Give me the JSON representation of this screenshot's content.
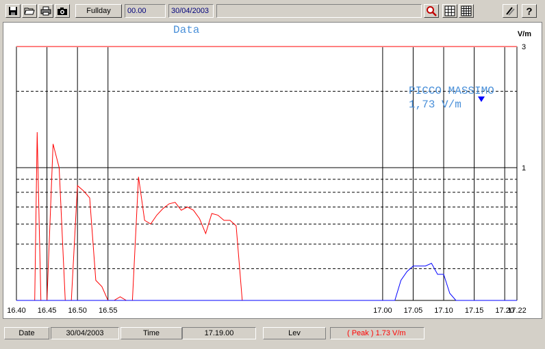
{
  "toolbar": {
    "range_label": "Fullday",
    "time_value": "00.00",
    "date_value": "30/04/2003",
    "icons": [
      "save-icon",
      "open-folder-icon",
      "print-icon",
      "camera-icon",
      "zoom-icon",
      "grid-icon",
      "grid-dense-icon",
      "tools-icon",
      "help-icon"
    ]
  },
  "chart_data": {
    "type": "line",
    "title": "Data",
    "ylabel": "V/m",
    "y_tick_labels": [
      "3",
      "1"
    ],
    "x_tick_labels": [
      "16.40",
      "16.45",
      "16.50",
      "16.55",
      "17.00",
      "17.05",
      "17.10",
      "17.15",
      "17.20",
      "17.22"
    ],
    "x_range": [
      16.4,
      17.22
    ],
    "y_scale": "log",
    "y_range": [
      0.3,
      3
    ],
    "limit_line": 3,
    "annotation": {
      "line1": "PICCO MASSIMO",
      "line2": "1,73 V/m",
      "x": 17.19,
      "y": 1.73
    },
    "series": [
      {
        "color": "#ff0000",
        "points": [
          [
            16.4,
            0.3
          ],
          [
            16.42,
            0.3
          ],
          [
            16.43,
            0.3
          ],
          [
            16.434,
            1.38
          ],
          [
            16.44,
            0.3
          ],
          [
            16.45,
            0.3
          ],
          [
            16.46,
            1.24
          ],
          [
            16.47,
            1.0
          ],
          [
            16.48,
            0.3
          ],
          [
            16.49,
            0.3
          ],
          [
            16.5,
            0.85
          ],
          [
            16.51,
            0.81
          ],
          [
            16.52,
            0.76
          ],
          [
            16.53,
            0.36
          ],
          [
            16.54,
            0.34
          ],
          [
            16.55,
            0.3
          ],
          [
            16.56,
            0.3
          ],
          [
            16.57,
            0.31
          ],
          [
            16.58,
            0.3
          ],
          [
            16.59,
            0.3
          ],
          [
            16.6,
            0.92
          ],
          [
            16.61,
            0.62
          ],
          [
            16.62,
            0.6
          ],
          [
            16.63,
            0.65
          ],
          [
            16.64,
            0.69
          ],
          [
            16.65,
            0.72
          ],
          [
            16.66,
            0.73
          ],
          [
            16.67,
            0.68
          ],
          [
            16.68,
            0.7
          ],
          [
            16.69,
            0.68
          ],
          [
            16.7,
            0.63
          ],
          [
            16.71,
            0.55
          ],
          [
            16.72,
            0.66
          ],
          [
            16.73,
            0.65
          ],
          [
            16.74,
            0.62
          ],
          [
            16.75,
            0.62
          ],
          [
            16.76,
            0.59
          ],
          [
            16.765,
            0.42
          ],
          [
            16.77,
            0.3
          ],
          [
            16.78,
            0.3
          ],
          [
            16.79,
            0.3
          ],
          [
            16.8,
            0.3
          ],
          [
            16.81,
            0.3
          ],
          [
            16.82,
            0.3
          ],
          [
            16.83,
            0.3
          ],
          [
            16.84,
            0.3
          ],
          [
            16.85,
            0.3
          ],
          [
            16.86,
            0.3
          ],
          [
            16.87,
            0.3
          ],
          [
            16.88,
            0.3
          ],
          [
            16.89,
            0.3
          ]
        ]
      },
      {
        "color": "#0000ff",
        "points": [
          [
            16.4,
            0.3
          ],
          [
            17.02,
            0.3
          ],
          [
            17.03,
            0.36
          ],
          [
            17.04,
            0.39
          ],
          [
            17.05,
            0.41
          ],
          [
            17.06,
            0.41
          ],
          [
            17.07,
            0.41
          ],
          [
            17.08,
            0.42
          ],
          [
            17.09,
            0.38
          ],
          [
            17.1,
            0.38
          ],
          [
            17.11,
            0.32
          ],
          [
            17.12,
            0.3
          ],
          [
            17.22,
            0.3
          ]
        ]
      }
    ]
  },
  "status": {
    "date_label": "Date",
    "date_value": "30/04/2003",
    "time_label": "Time",
    "time_value": "17.19.00",
    "lev_label": "Lev",
    "peak_prefix": "( Peak )",
    "peak_value": "1.73 V/m"
  },
  "colors": {
    "series_red": "#ff0000",
    "series_blue": "#0000ff",
    "title_blue": "#4a90d9",
    "limit_line": "#ff8080"
  }
}
